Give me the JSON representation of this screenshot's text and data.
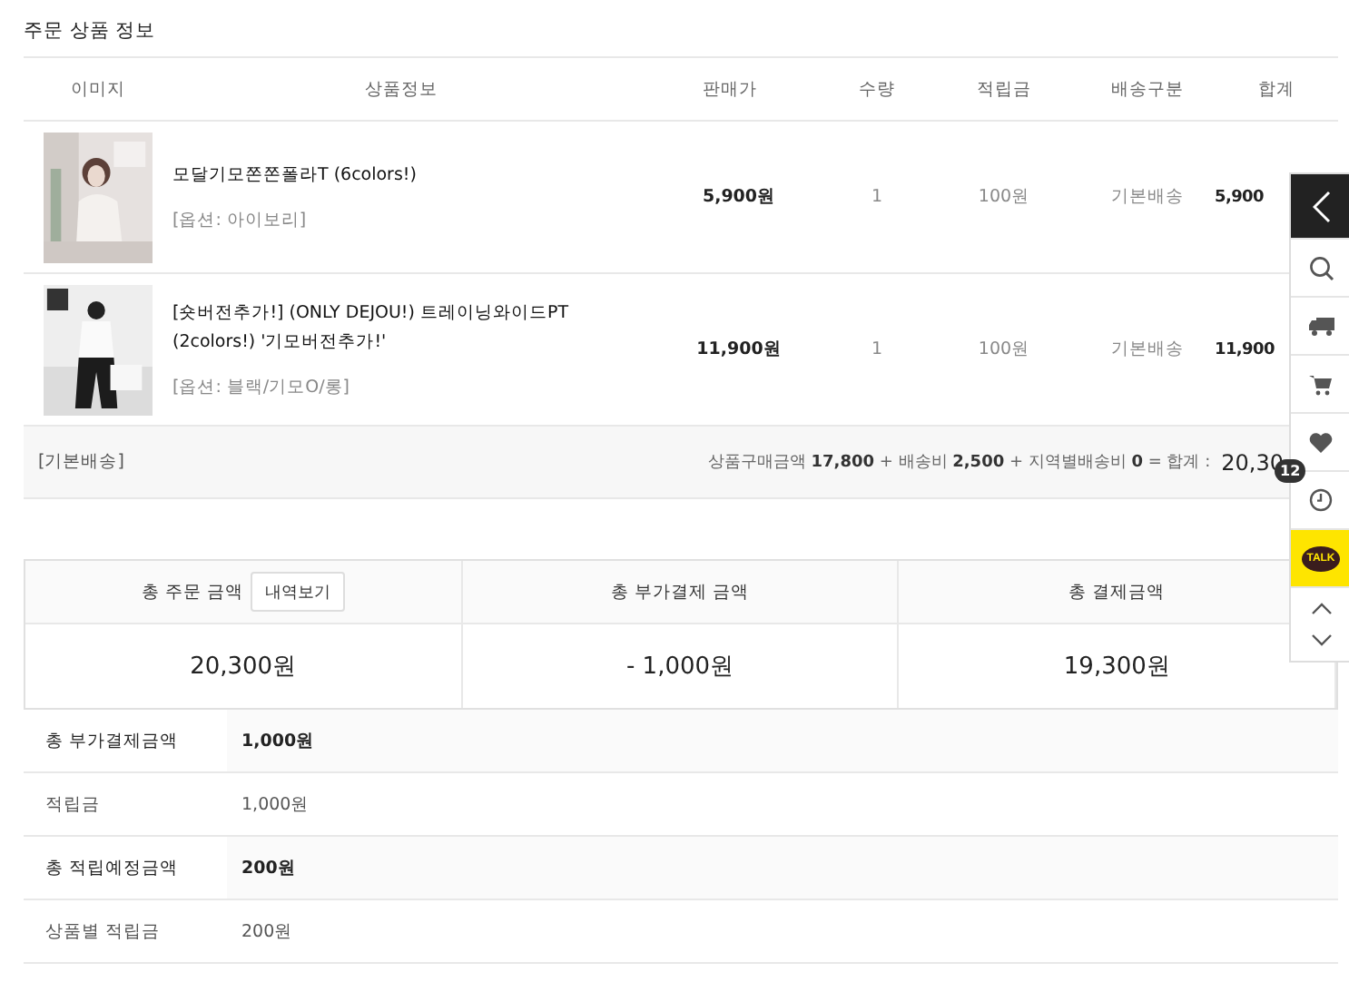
{
  "section_title": "주문 상품 정보",
  "columns": [
    "이미지",
    "상품정보",
    "판매가",
    "수량",
    "적립금",
    "배송구분",
    "합계"
  ],
  "items": [
    {
      "name": "모달기모쫀쫀폴라T (6colors!)",
      "option": "[옵션: 아이보리]",
      "price": "5,900원",
      "quantity": "1",
      "points": "100원",
      "shipping": "기본배송",
      "total": "5,900"
    },
    {
      "name": "[숏버전추가!] (ONLY DEJOU!) 트레이닝와이드PT (2colors!) '기모버전추가!'",
      "option": "[옵션: 블랙/기모O/롱]",
      "price": "11,900원",
      "quantity": "1",
      "points": "100원",
      "shipping": "기본배송",
      "total": "11,900"
    }
  ],
  "summary": {
    "label": "[기본배송]",
    "breakdown": "상품구매금액 **17,800** + 배송비 **2,500** + 지역별배송비 **0** = 합계 :",
    "total": "20,30"
  },
  "totals": {
    "order_label": "총 주문 금액",
    "details_button": "내역보기",
    "extra_label": "총 부가결제 금액",
    "pay_label": "총 결제금액",
    "order_value": "20,300원",
    "extra_value": "- 1,000원",
    "pay_value": "19,300원"
  },
  "details": [
    {
      "label": "총 부가결제금액",
      "value": "1,000원",
      "kind": "total"
    },
    {
      "label": "적립금",
      "value": "1,000원",
      "kind": "sub"
    },
    {
      "label": "총 적립예정금액",
      "value": "200원",
      "kind": "total"
    },
    {
      "label": "상품별 적립금",
      "value": "200원",
      "kind": "sub"
    }
  ],
  "quick_bar": {
    "kakao_label": "TALK",
    "recent_count": "12"
  }
}
